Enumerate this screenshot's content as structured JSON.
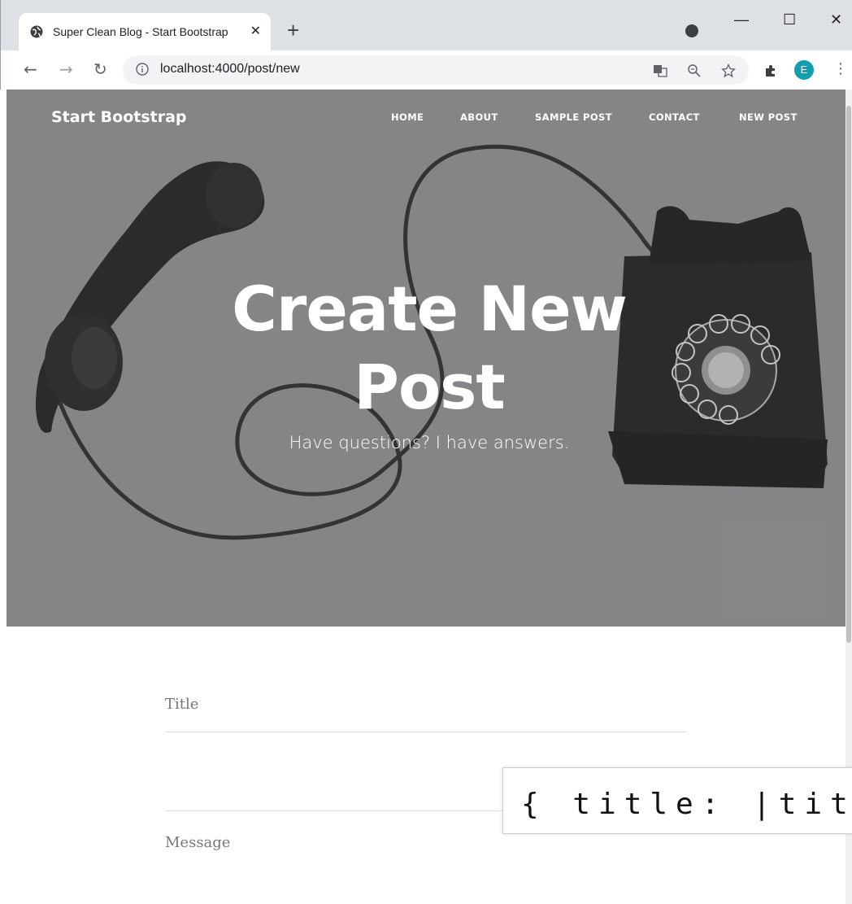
{
  "browser": {
    "tab_title": "Super Clean Blog - Start Bootstrap",
    "new_tab_symbol": "+",
    "close_symbol": "✕",
    "window": {
      "minimize": "—",
      "maximize": "☐",
      "close": "✕"
    },
    "url": "localhost:4000/post/new",
    "profile_initial": "E"
  },
  "site": {
    "brand": "Start Bootstrap",
    "nav": [
      "HOME",
      "ABOUT",
      "SAMPLE POST",
      "CONTACT",
      "NEW POST"
    ]
  },
  "hero": {
    "title_line1": "Create New",
    "title_line2": "Post",
    "subtitle": "Have questions? I have answers."
  },
  "form": {
    "title_placeholder": "Title",
    "message_placeholder": "Message"
  },
  "overlay": {
    "text": "{ title: |title"
  },
  "colors": {
    "hero_bg": "#8c8d8f",
    "avatar": "#129eaf"
  }
}
